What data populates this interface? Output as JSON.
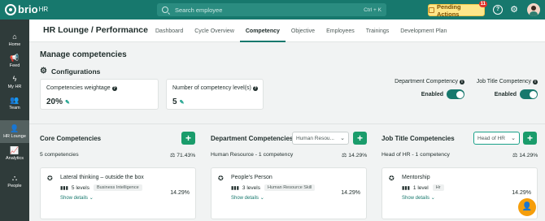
{
  "app": {
    "logo": "brio",
    "logo_suffix": "HR"
  },
  "search": {
    "placeholder": "Search employee",
    "shortcut": "Ctrl + K"
  },
  "pending_actions": {
    "label": "Pending Actions",
    "count": "11"
  },
  "sidebar": {
    "items": [
      {
        "label": "Home",
        "icon": "home-icon"
      },
      {
        "label": "Feed",
        "icon": "megaphone-icon"
      },
      {
        "label": "My HR",
        "icon": "lightning-icon"
      },
      {
        "label": "Team",
        "icon": "team-icon"
      },
      {
        "label": "HR Lounge",
        "icon": "people-icon",
        "active": true
      },
      {
        "label": "Analytics",
        "icon": "chart-icon"
      },
      {
        "label": "People",
        "icon": "org-icon"
      }
    ]
  },
  "header": {
    "breadcrumb": "HR Lounge / Performance",
    "tabs": [
      "Dashboard",
      "Cycle Overview",
      "Competency",
      "Objective",
      "Employees",
      "Trainings",
      "Development Plan"
    ],
    "active_tab": "Competency"
  },
  "main": {
    "title": "Manage competencies",
    "config_title": "Configurations",
    "weightage": {
      "label": "Competencies weightage",
      "value": "20%"
    },
    "levels": {
      "label": "Number of competency level(s)",
      "value": "5"
    },
    "department_toggle": {
      "label": "Department Competency",
      "state": "Enabled"
    },
    "jobtitle_toggle": {
      "label": "Job Title Competency",
      "state": "Enabled"
    }
  },
  "columns": {
    "core": {
      "title": "Core Competencies",
      "subtitle": "5 competencies",
      "percent": "71.43%",
      "card": {
        "name": "Lateral thinking – outside the box",
        "levels": "5 levels",
        "tag": "Business Intelligence",
        "show": "Show details",
        "percent": "14.29%"
      }
    },
    "department": {
      "title": "Department Competencies",
      "select": "Human Resou...",
      "subtitle": "Human Resource - 1 competency",
      "percent": "14.29%",
      "card": {
        "name": "People's Person",
        "levels": "3 levels",
        "tag": "Human Resource Skill",
        "show": "Show details",
        "percent": "14.29%"
      }
    },
    "jobtitle": {
      "title": "Job Title Competencies",
      "select": "Head of HR",
      "subtitle": "Head of HR - 1 competency",
      "percent": "14.29%",
      "card": {
        "name": "Mentorship",
        "levels": "1 level",
        "tag": "Hr",
        "show": "Show details",
        "percent": "14.29%"
      }
    }
  },
  "colors": {
    "brand": "#17786d",
    "add_button": "#1a9c6b",
    "pending": "#fde68a",
    "fab": "#f59e0b"
  }
}
